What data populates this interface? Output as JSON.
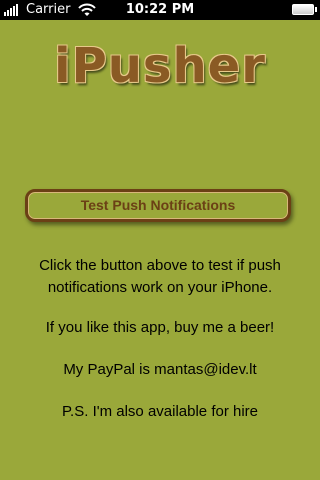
{
  "status_bar": {
    "carrier": "Carrier",
    "time": "10:22 PM"
  },
  "app": {
    "title": "iPusher"
  },
  "button": {
    "label": "Test Push Notifications"
  },
  "info": {
    "line1a": "Click the button above to test if push",
    "line1b": "notifications work on your iPhone.",
    "line2": "If you like this app, buy me a beer!",
    "line3": "My PayPal is mantas@idev.lt",
    "line4": "P.S. I'm also available for hire"
  },
  "colors": {
    "background": "#9aa83a",
    "title": "#8a5a24",
    "button_border": "#6b4015"
  },
  "icons": [
    "signal-icon",
    "wifi-icon",
    "battery-icon"
  ]
}
